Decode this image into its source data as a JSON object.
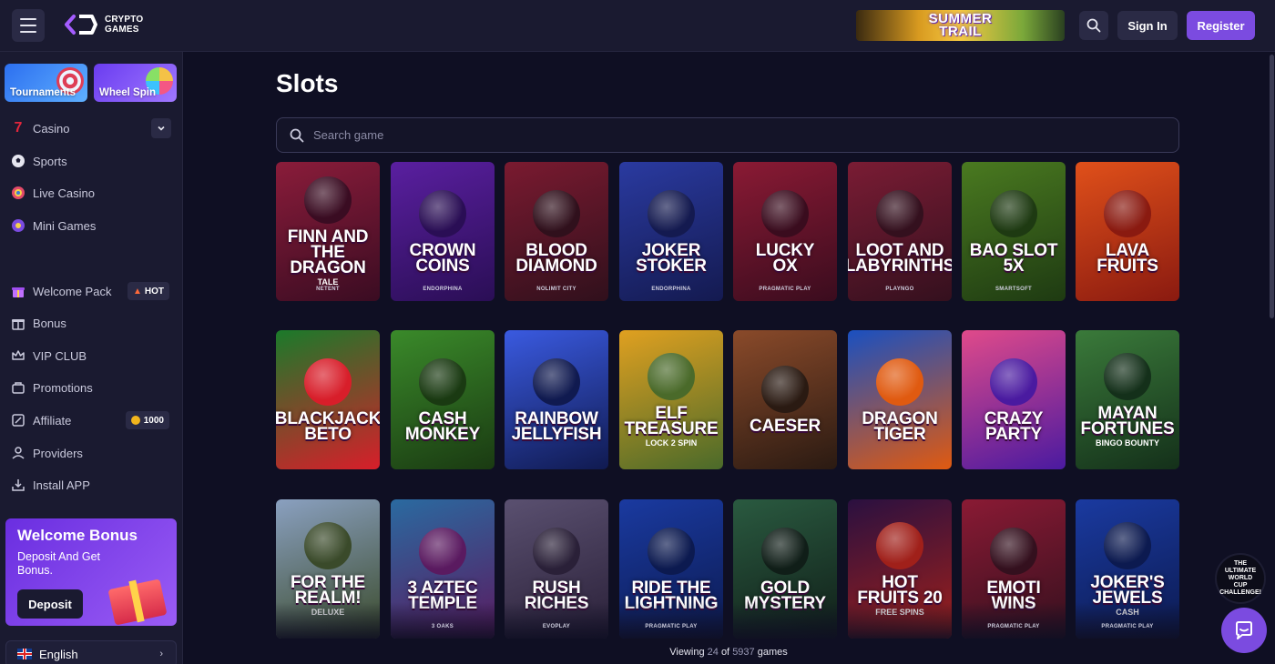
{
  "header": {
    "logo_text": "CRYPTO\nGAMES",
    "promo_banner": "SUMMER\nTRAIL",
    "sign_in": "Sign In",
    "register": "Register"
  },
  "sidebar": {
    "tiles": [
      {
        "label": "Tournaments"
      },
      {
        "label": "Wheel Spin"
      }
    ],
    "nav": [
      {
        "label": "Casino",
        "icon": "seven-icon"
      },
      {
        "label": "Sports",
        "icon": "soccer-ball-icon"
      },
      {
        "label": "Live Casino",
        "icon": "live-chip-icon"
      },
      {
        "label": "Mini Games",
        "icon": "mini-games-icon"
      }
    ],
    "nav2": [
      {
        "label": "Welcome Pack",
        "icon": "gift-icon",
        "badge": "HOT"
      },
      {
        "label": "Bonus",
        "icon": "bonus-gift-icon"
      },
      {
        "label": "VIP CLUB",
        "icon": "crown-icon"
      },
      {
        "label": "Promotions",
        "icon": "promotions-icon"
      },
      {
        "label": "Affiliate",
        "icon": "affiliate-icon",
        "badge": "1000"
      },
      {
        "label": "Providers",
        "icon": "providers-icon"
      },
      {
        "label": "Install APP",
        "icon": "install-icon"
      }
    ],
    "welcome": {
      "title": "Welcome Bonus",
      "subtitle": "Deposit And Get Bonus.",
      "button": "Deposit"
    },
    "language": "English"
  },
  "main": {
    "title": "Slots",
    "search_placeholder": "Search game",
    "viewing": {
      "prefix": "Viewing",
      "count": "24",
      "of": "of",
      "total": "5937",
      "suffix": "games"
    }
  },
  "games": [
    {
      "title": "FINN AND\nTHE DRAGON",
      "sub": "TALE",
      "provider": "NETENT",
      "bg": "#8a1c3a",
      "bg2": "#3a0c22"
    },
    {
      "title": "CROWN\nCOINS",
      "sub": "",
      "provider": "ENDORPHINA",
      "bg": "#5a1fa0",
      "bg2": "#2a0e55"
    },
    {
      "title": "BLOOD\nDIAMOND",
      "sub": "",
      "provider": "NOLIMIT CITY",
      "bg": "#7a1a30",
      "bg2": "#30101c"
    },
    {
      "title": "JOKER\nSTOKER",
      "sub": "",
      "provider": "ENDORPHINA",
      "bg": "#2a3aa0",
      "bg2": "#141a50"
    },
    {
      "title": "LUCKY\nOX",
      "sub": "",
      "provider": "PRAGMATIC PLAY",
      "bg": "#8a1a34",
      "bg2": "#3a0c1e"
    },
    {
      "title": "LOOT AND\nLABYRINTHS",
      "sub": "",
      "provider": "PLAYNGO",
      "bg": "#7a1c34",
      "bg2": "#34101e"
    },
    {
      "title": "BAO SLOT\n5X",
      "sub": "",
      "provider": "SMARTSOFT",
      "bg": "#4a7a20",
      "bg2": "#1e3a12"
    },
    {
      "title": "LAVA\nFRUITS",
      "sub": "",
      "provider": "",
      "bg": "#e0501a",
      "bg2": "#8a1a10"
    },
    {
      "title": "BLACKJACK\nBETO",
      "sub": "",
      "provider": "",
      "bg": "#1a7a2a",
      "bg2": "#d81e2a"
    },
    {
      "title": "CASH\nMONKEY",
      "sub": "",
      "provider": "",
      "bg": "#3a8a2a",
      "bg2": "#1a3a12"
    },
    {
      "title": "RAINBOW\nJELLYFISH",
      "sub": "",
      "provider": "",
      "bg": "#3a5ae0",
      "bg2": "#101a50"
    },
    {
      "title": "ELF\nTREASURE",
      "sub": "LOCK 2 SPIN",
      "provider": "",
      "bg": "#e0a020",
      "bg2": "#4a6a2a"
    },
    {
      "title": "CAESER",
      "sub": "",
      "provider": "",
      "bg": "#8a4a2a",
      "bg2": "#2a1a12"
    },
    {
      "title": "DRAGON\nTIGER",
      "sub": "",
      "provider": "",
      "bg": "#1a50c0",
      "bg2": "#e05a10"
    },
    {
      "title": "CRAZY\nPARTY",
      "sub": "",
      "provider": "",
      "bg": "#e04a8a",
      "bg2": "#4a1aa0"
    },
    {
      "title": "MAYAN\nFORTUNES",
      "sub": "BINGO BOUNTY",
      "provider": "",
      "bg": "#3a7a3a",
      "bg2": "#14301a"
    },
    {
      "title": "FOR THE\nREALM!",
      "sub": "DELUXE",
      "provider": "",
      "bg": "#8aa0c0",
      "bg2": "#3a4a2a"
    },
    {
      "title": "3 AZTEC\nTEMPLE",
      "sub": "",
      "provider": "3 OAKS",
      "bg": "#2a6aa0",
      "bg2": "#5a1a60"
    },
    {
      "title": "RUSH\nRICHES",
      "sub": "",
      "provider": "EVOPLAY",
      "bg": "#5a5070",
      "bg2": "#2a2038"
    },
    {
      "title": "RIDE THE\nLIGHTNING",
      "sub": "",
      "provider": "PRAGMATIC PLAY",
      "bg": "#1a3aa0",
      "bg2": "#0c1a50"
    },
    {
      "title": "GOLD\nMYSTERY",
      "sub": "",
      "provider": "",
      "bg": "#2a5a40",
      "bg2": "#101e18"
    },
    {
      "title": "HOT\nFRUITS 20",
      "sub": "FREE SPINS",
      "provider": "",
      "bg": "#2a1040",
      "bg2": "#a0201a"
    },
    {
      "title": "EMOTI\nWINS",
      "sub": "",
      "provider": "PRAGMATIC PLAY",
      "bg": "#8a1a34",
      "bg2": "#34101e"
    },
    {
      "title": "JOKER'S\nJEWELS",
      "sub": "CASH",
      "provider": "PRAGMATIC PLAY",
      "bg": "#1a3aa0",
      "bg2": "#0c1a50"
    }
  ],
  "floating": {
    "world_cup": "THE\nULTIMATE\nWORLD\nCUP\nCHALLENGE!"
  },
  "colors": {
    "accent": "#7b4be0",
    "background": "#0f0f23",
    "panel": "#1a1a30"
  }
}
